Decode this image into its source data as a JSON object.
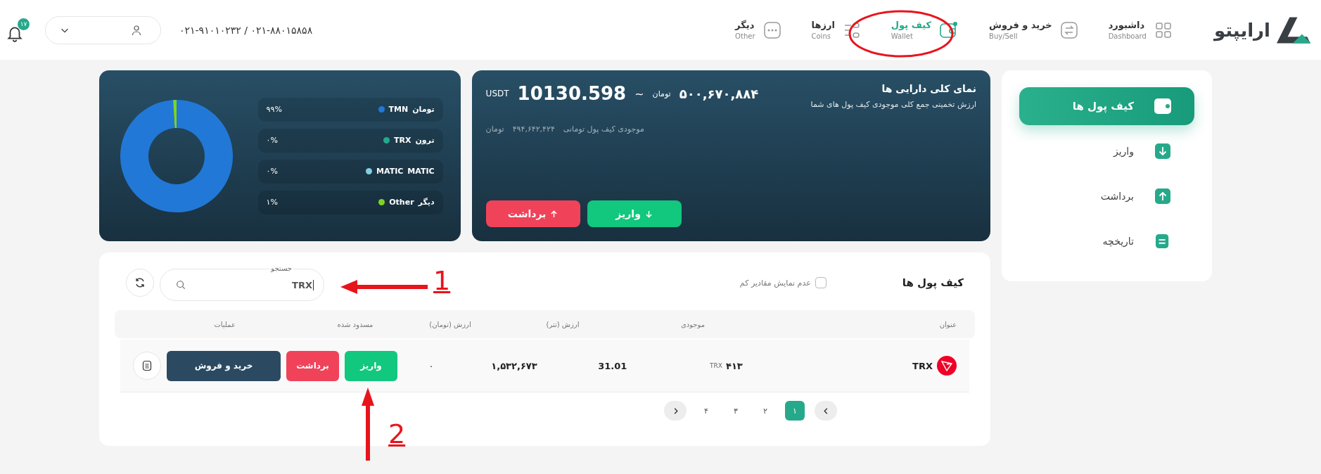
{
  "header": {
    "logo": "ارایپتو",
    "notifications": "۱۷",
    "phone": "۰۲۱-۹۱۰۱۰۲۳۲ / ۰۲۱-۸۸۰۱۵۸۵۸",
    "nav": [
      {
        "label": "داشبورد",
        "sublabel": "Dashboard",
        "selected": false
      },
      {
        "label": "خرید و فروش",
        "sublabel": "Buy/Sell",
        "selected": false
      },
      {
        "label": "کیف پول",
        "sublabel": "Wallet",
        "selected": true
      },
      {
        "label": "ارزها",
        "sublabel": "Coins",
        "selected": false
      },
      {
        "label": "دیگر",
        "sublabel": "Other",
        "selected": false
      }
    ]
  },
  "sidebar": {
    "items": [
      {
        "label": "کیف پول ها",
        "selected": true
      },
      {
        "label": "واریز",
        "selected": false
      },
      {
        "label": "برداشت",
        "selected": false
      },
      {
        "label": "تاریخچه",
        "selected": false
      }
    ]
  },
  "summary": {
    "title": "نمای کلی دارایی ها",
    "subtitle": "ارزش تخمینی جمع کلی موجودی کیف پول های شما",
    "toman_value": "۵۰۰,۶۷۰,۸۸۴",
    "toman_unit": "تومان",
    "approx": "~",
    "usdt_value": "10130.598",
    "usdt_unit": "USDT",
    "wallet_label": "موجودی کیف پول تومانی",
    "wallet_value": "۴۹۴,۶۴۲,۴۲۴",
    "wallet_unit": "تومان",
    "buttons": [
      {
        "label": "واریز",
        "kind": "deposit"
      },
      {
        "label": "برداشت",
        "kind": "withdraw"
      }
    ]
  },
  "distribution": {
    "chart_data": {
      "type": "donut",
      "categories": [
        "TMN",
        "TRX",
        "MATIC",
        "Other"
      ],
      "values": [
        99,
        0,
        0,
        1
      ]
    },
    "legend": [
      {
        "label": "تومان",
        "percent": "۹۹%",
        "color": "#2178d6"
      },
      {
        "label": "ترون",
        "percent": "۰%",
        "color": "#26a98b"
      },
      {
        "label": "MATIC",
        "percent": "۰%",
        "color": "#7fd0e0"
      },
      {
        "label": "دیگر",
        "percent": "۱%",
        "color": "#7ed321"
      }
    ]
  },
  "wallets": {
    "title": "کیف پول ها",
    "hide_small": {
      "label": "عدم نمایش مقادیر کم",
      "checked": false
    },
    "search": {
      "label": "جستجو",
      "value": "TRX"
    },
    "columns": [
      "عنوان",
      "موجودی",
      "ارزش (تتر)",
      "ارزش (تومان)",
      "مسدود شده",
      "عملیات"
    ],
    "rows": [
      {
        "name": "TRX",
        "balance": "۴۱۳",
        "balance_unit": "TRX",
        "value_usdt": "31.01",
        "value_toman": "۱,۵۳۲,۶۷۳",
        "blocked": "۰",
        "actions": [
          {
            "label": "واریز",
            "kind": "deposit"
          },
          {
            "label": "برداشت",
            "kind": "withdraw"
          },
          {
            "label": "خرید و فروش",
            "kind": "trade"
          }
        ]
      }
    ],
    "pages": [
      {
        "label": "۱",
        "selected": true
      },
      {
        "label": "۲",
        "selected": false
      },
      {
        "label": "۳",
        "selected": false
      },
      {
        "label": "۴",
        "selected": false
      }
    ]
  },
  "annotations": [
    {
      "kind": "arrow-left",
      "number": "1"
    },
    {
      "kind": "arrow-up",
      "number": "2"
    },
    {
      "kind": "ellipse"
    }
  ]
}
